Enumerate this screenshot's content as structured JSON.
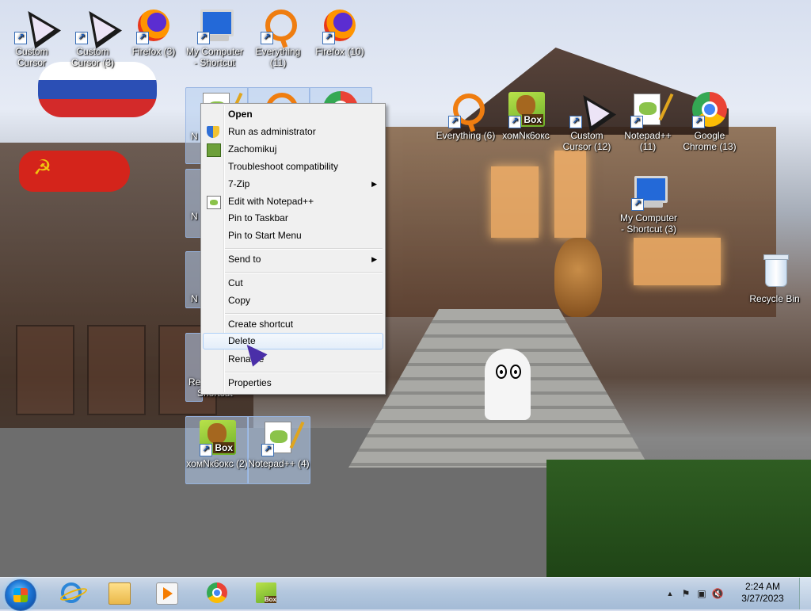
{
  "desktop_icons": [
    {
      "label": "Custom Cursor",
      "icon": "cursor-icon"
    },
    {
      "label": "Custom Cursor (3)",
      "icon": "cursor-icon"
    },
    {
      "label": "Firefox (3)",
      "icon": "firefox-icon"
    },
    {
      "label": "My Computer - Shortcut",
      "icon": "computer-icon"
    },
    {
      "label": "Everything (11)",
      "icon": "everything-icon"
    },
    {
      "label": "Firefox (10)",
      "icon": "firefox-icon"
    },
    {
      "label": "Everything (6)",
      "icon": "everything-icon"
    },
    {
      "label": "хомNк6окс",
      "icon": "hamster-box-icon"
    },
    {
      "label": "Custom Cursor (12)",
      "icon": "cursor-icon"
    },
    {
      "label": "Notepad++ (11)",
      "icon": "notepadpp-icon"
    },
    {
      "label": "Google Chrome (13)",
      "icon": "chrome-icon"
    },
    {
      "label": "My Computer - Shortcut (3)",
      "icon": "computer-icon"
    },
    {
      "label": "Recycle Bin",
      "icon": "recycle-bin-icon"
    },
    {
      "label": "хомNк6окс (2)",
      "icon": "hamster-box-icon"
    },
    {
      "label": "Notepad++ (4)",
      "icon": "notepadpp-icon"
    }
  ],
  "partial_labels": {
    "n1": "N",
    "n2": "N",
    "n3": "N",
    "n4": "N",
    "re": "Re",
    "shortcut": "Shortcut"
  },
  "context_menu": {
    "items": [
      {
        "label": "Open",
        "bold": true
      },
      {
        "label": "Run as administrator",
        "icon": "uac-shield-icon"
      },
      {
        "label": "Zachomikuj",
        "icon": "zachomikuj-icon"
      },
      {
        "label": "Troubleshoot compatibility"
      },
      {
        "label": "7-Zip",
        "submenu": true
      },
      {
        "label": "Edit with Notepad++",
        "icon": "notepadpp-icon"
      },
      {
        "label": "Pin to Taskbar"
      },
      {
        "label": "Pin to Start Menu"
      },
      {
        "label": "Send to",
        "submenu": true
      },
      {
        "label": "Cut"
      },
      {
        "label": "Copy"
      },
      {
        "label": "Create shortcut"
      },
      {
        "label": "Delete",
        "highlighted": true
      },
      {
        "label": "Rename"
      },
      {
        "label": "Properties"
      }
    ]
  },
  "taskbar": {
    "pinned": [
      "internet-explorer-icon",
      "explorer-folder-icon",
      "media-player-icon",
      "chrome-icon",
      "hamster-box-icon"
    ],
    "clock_time": "2:24 AM",
    "clock_date": "3/27/2023",
    "tray_up_arrow": "▲"
  },
  "colors": {
    "taskbar": "#b3c7de",
    "menu_bg": "#f0f0f0",
    "menu_highlight_border": "#aecff7"
  }
}
